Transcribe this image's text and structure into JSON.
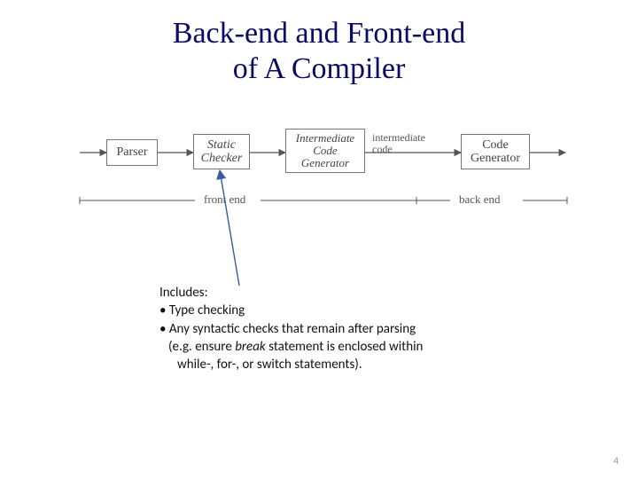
{
  "title_line1": "Back-end and Front-end",
  "title_line2": "of A Compiler",
  "boxes": {
    "parser": "Parser",
    "checker_l1": "Static",
    "checker_l2": "Checker",
    "icg_l1": "Intermediate",
    "icg_l2": "Code",
    "icg_l3": "Generator",
    "codegen_l1": "Code",
    "codegen_l2": "Generator"
  },
  "flow": {
    "intermediate_l1": "intermediate",
    "intermediate_l2": "code",
    "front_end": "front end",
    "back_end": "back end"
  },
  "notes": {
    "heading": "Includes:",
    "b1": "• Type checking",
    "b2": "• Any syntactic checks that remain after parsing",
    "b3a": "(e.g. ensure ",
    "b3_break": "break",
    "b3b": " statement is enclosed within",
    "b4": "while-, for-, or switch statements)."
  },
  "page": "4"
}
